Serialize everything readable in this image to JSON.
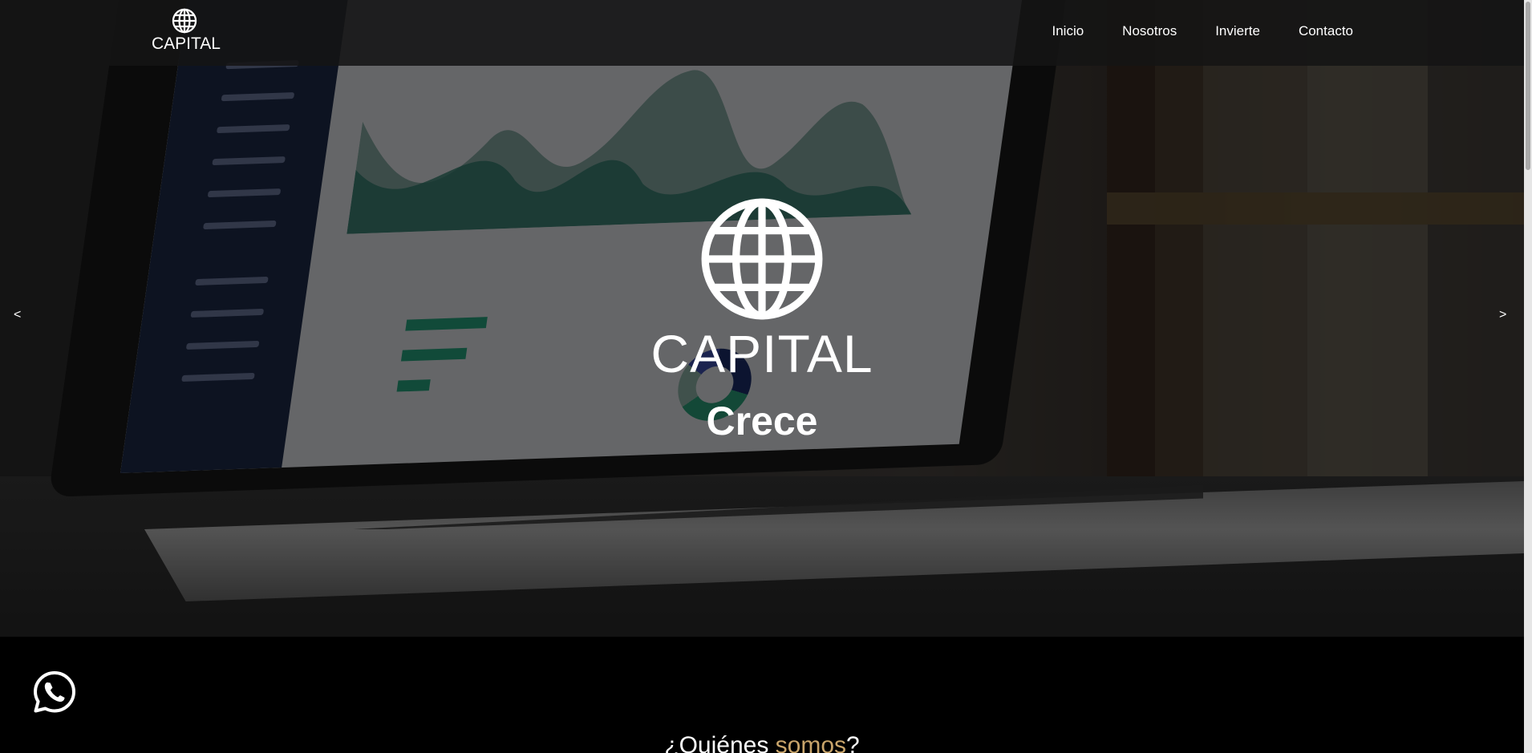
{
  "header": {
    "brand_text": "CAPITAL",
    "brand_icon": "globe-icon",
    "nav": [
      {
        "label": "Inicio"
      },
      {
        "label": "Nosotros"
      },
      {
        "label": "Invierte"
      },
      {
        "label": "Contacto"
      }
    ]
  },
  "hero": {
    "icon": "globe-icon",
    "title": "CAPITAL",
    "subtitle": "Crece",
    "prev_label": "<",
    "next_label": ">"
  },
  "about": {
    "heading_prefix": "¿Quiénes ",
    "heading_accent": "somos",
    "heading_suffix": "?"
  },
  "floating": {
    "whatsapp_icon": "whatsapp-icon"
  },
  "colors": {
    "accent": "#c9a56b",
    "header_bg": "#141414",
    "text": "#ffffff"
  }
}
